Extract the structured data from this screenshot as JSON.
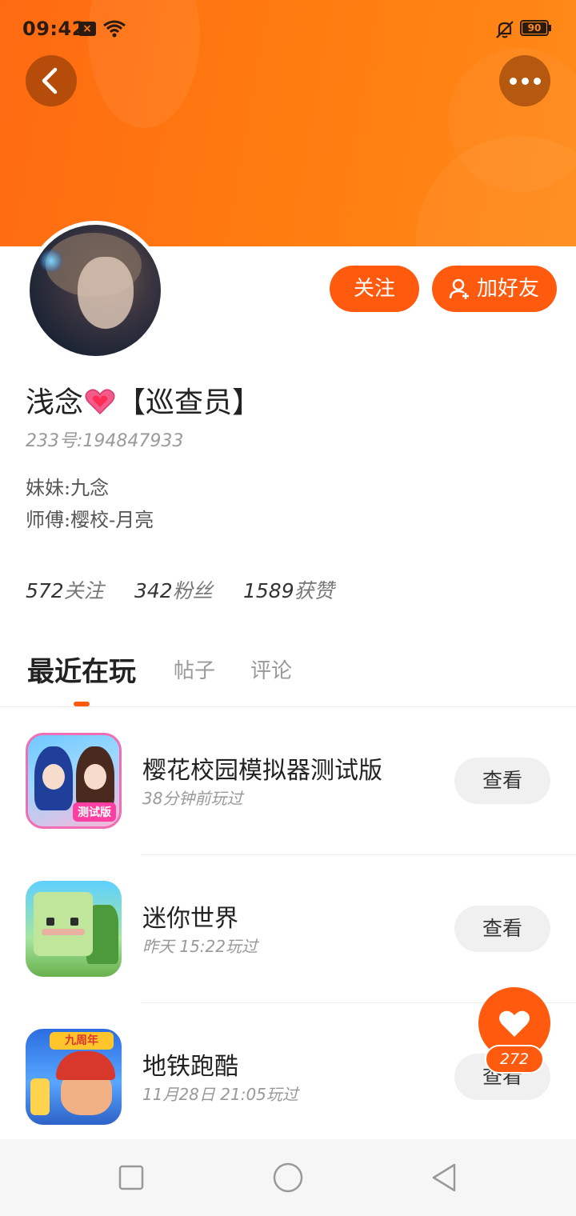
{
  "status_bar": {
    "time": "09:42",
    "battery": "90",
    "icons": [
      "sim-x-icon",
      "wifi-icon",
      "bell-off-icon",
      "battery-icon"
    ]
  },
  "header": {
    "back_icon": "chevron-left-icon",
    "more_icon": "more-dots-icon"
  },
  "profile": {
    "name_prefix": "浅念",
    "name_suffix": "【巡查员】",
    "uid": "233号:194847933",
    "bio": [
      "妹妹:九念",
      "师傅:樱校-月亮"
    ],
    "stats": [
      {
        "num": "572",
        "label": "关注"
      },
      {
        "num": "342",
        "label": "粉丝"
      },
      {
        "num": "1589",
        "label": "获赞"
      }
    ]
  },
  "actions": {
    "follow_label": "关注",
    "add_friend_label": "加好友"
  },
  "tabs": [
    {
      "label": "最近在玩",
      "active": true
    },
    {
      "label": "帖子",
      "active": false
    },
    {
      "label": "评论",
      "active": false
    }
  ],
  "games": [
    {
      "title": "樱花校园模拟器测试版",
      "subtitle": "38分钟前玩过",
      "button": "查看",
      "badge": "测试版"
    },
    {
      "title": "迷你世界",
      "subtitle": "昨天 15:22玩过",
      "button": "查看"
    },
    {
      "title": "地铁跑酷",
      "subtitle": "11月28日 21:05玩过",
      "button": "查看",
      "badge": "九周年"
    }
  ],
  "like": {
    "count": "272"
  },
  "colors": {
    "accent": "#ff5a0e",
    "banner": "#ff7a10"
  }
}
